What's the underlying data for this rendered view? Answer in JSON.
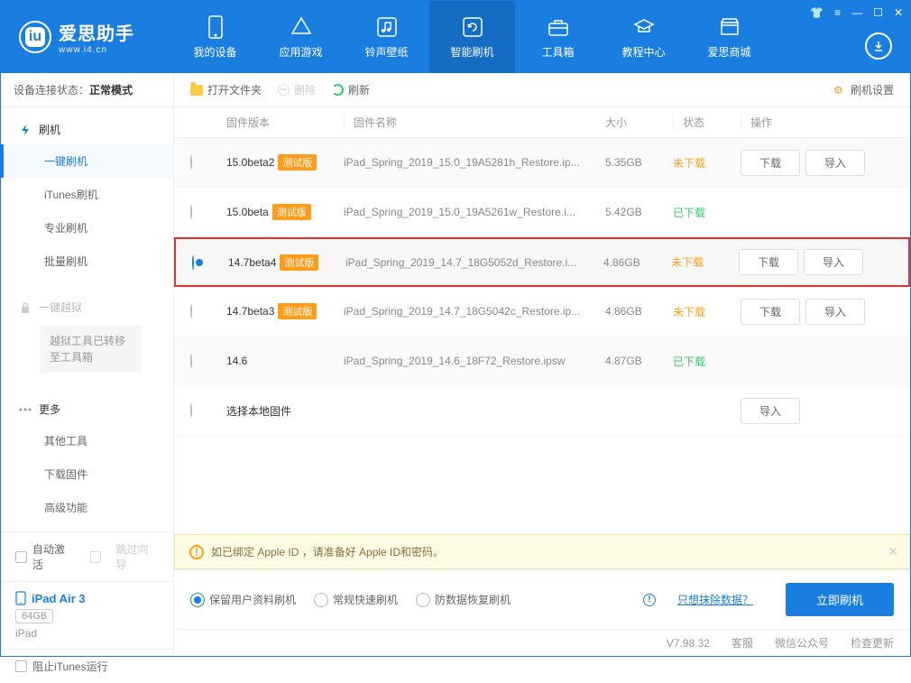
{
  "app": {
    "brand": "爱思助手",
    "url": "www.i4.cn"
  },
  "nav": [
    {
      "label": "我的设备"
    },
    {
      "label": "应用游戏"
    },
    {
      "label": "铃声壁纸"
    },
    {
      "label": "智能刷机"
    },
    {
      "label": "工具箱"
    },
    {
      "label": "教程中心"
    },
    {
      "label": "爱思商城"
    }
  ],
  "connection": {
    "label": "设备连接状态：",
    "mode": "正常模式"
  },
  "sidebar": {
    "flash": {
      "title": "刷机",
      "items": [
        "一键刷机",
        "iTunes刷机",
        "专业刷机",
        "批量刷机"
      ]
    },
    "jailbreak": {
      "title": "一键越狱",
      "notice": "越狱工具已转移至工具箱"
    },
    "more": {
      "title": "更多",
      "items": [
        "其他工具",
        "下载固件",
        "高级功能"
      ]
    }
  },
  "toolbar": {
    "open": "打开文件夹",
    "delete": "删除",
    "refresh": "刷新",
    "settings": "刷机设置"
  },
  "columns": {
    "version": "固件版本",
    "name": "固件名称",
    "size": "大小",
    "status": "状态",
    "action": "操作"
  },
  "beta_badge": "测试版",
  "rows": [
    {
      "selected": false,
      "version": "15.0beta2",
      "beta": true,
      "name": "iPad_Spring_2019_15.0_19A5281h_Restore.ip...",
      "size": "5.35GB",
      "status": "未下载",
      "status_class": "st-notdl",
      "actions": [
        "下载",
        "导入"
      ]
    },
    {
      "selected": false,
      "version": "15.0beta",
      "beta": true,
      "name": "iPad_Spring_2019_15.0_19A5261w_Restore.i...",
      "size": "5.42GB",
      "status": "已下载",
      "status_class": "st-dl",
      "actions": []
    },
    {
      "selected": true,
      "highlighted": true,
      "version": "14.7beta4",
      "beta": true,
      "name": "iPad_Spring_2019_14.7_18G5052d_Restore.i...",
      "size": "4.86GB",
      "status": "未下载",
      "status_class": "st-notdl",
      "actions": [
        "下载",
        "导入"
      ]
    },
    {
      "selected": false,
      "version": "14.7beta3",
      "beta": true,
      "name": "iPad_Spring_2019_14.7_18G5042c_Restore.ip...",
      "size": "4.86GB",
      "status": "未下载",
      "status_class": "st-notdl",
      "actions": [
        "下载",
        "导入"
      ]
    },
    {
      "selected": false,
      "version": "14.6",
      "beta": false,
      "name": "iPad_Spring_2019_14.6_18F72_Restore.ipsw",
      "size": "4.87GB",
      "status": "已下载",
      "status_class": "st-dl",
      "actions": []
    },
    {
      "selected": false,
      "version": "选择本地固件",
      "beta": false,
      "name": "",
      "size": "",
      "status": "",
      "status_class": "",
      "actions": [
        "导入"
      ],
      "local": true
    }
  ],
  "warning": "如已绑定 Apple ID ，请准备好 Apple ID和密码。",
  "flash_options": [
    "保留用户资料刷机",
    "常规快速刷机",
    "防数据恢复刷机"
  ],
  "erase_link": "只想抹除数据？",
  "flash_btn": "立即刷机",
  "checkboxes": {
    "auto_activate": "自动激活",
    "skip_guide": "跳过向导",
    "block_itunes": "阻止iTunes运行"
  },
  "device": {
    "name": "iPad Air 3",
    "capacity": "64GB",
    "type": "iPad"
  },
  "statusbar": {
    "version": "V7.98.32",
    "service": "客服",
    "wechat": "微信公众号",
    "update": "检查更新"
  }
}
